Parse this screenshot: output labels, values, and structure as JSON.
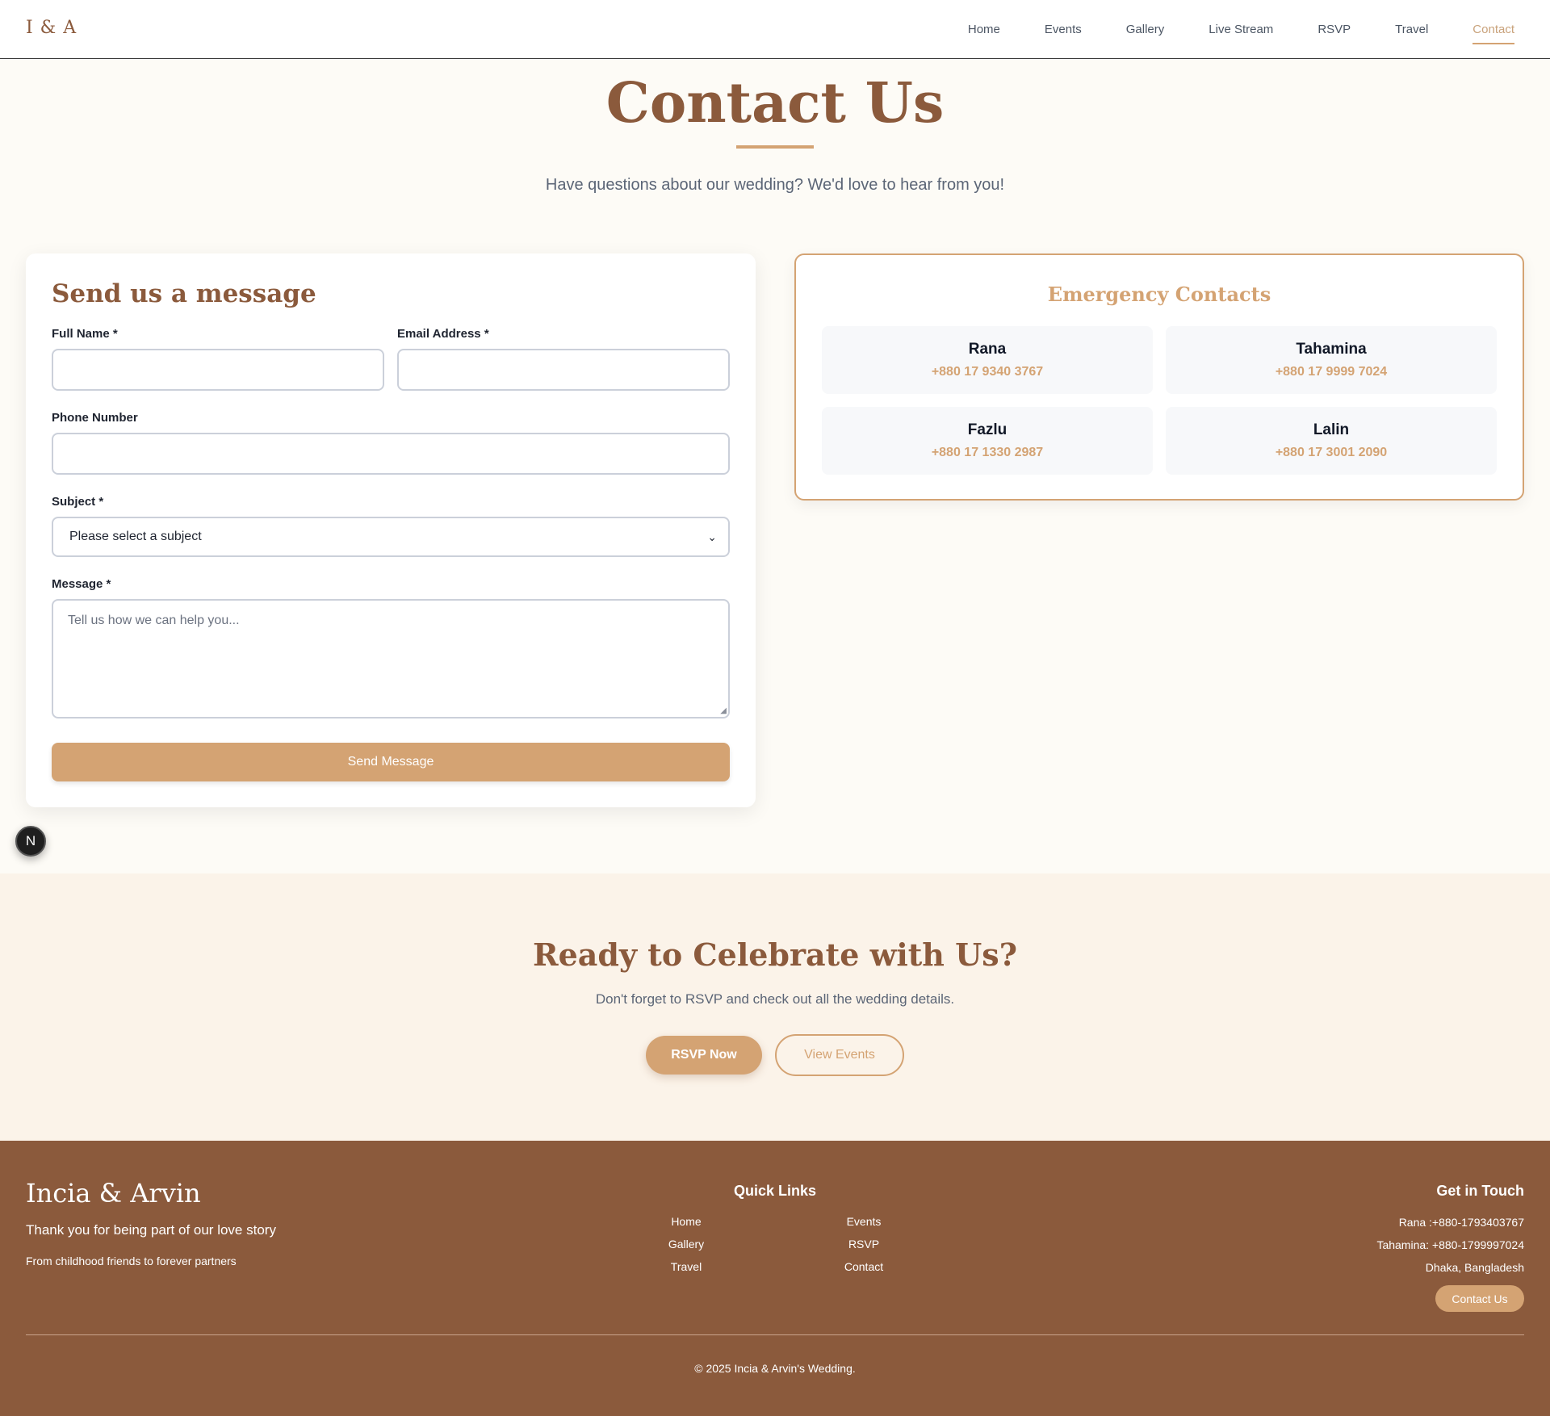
{
  "header": {
    "logo": "I & A",
    "nav": [
      {
        "label": "Home"
      },
      {
        "label": "Events"
      },
      {
        "label": "Gallery"
      },
      {
        "label": "Live Stream"
      },
      {
        "label": "RSVP"
      },
      {
        "label": "Travel"
      },
      {
        "label": "Contact",
        "active": true
      }
    ]
  },
  "hero": {
    "title": "Contact Us",
    "subtitle": "Have questions about our wedding? We'd love to hear from you!"
  },
  "form": {
    "title": "Send us a message",
    "full_name_label": "Full Name *",
    "full_name_value": "",
    "email_label": "Email Address *",
    "email_value": "",
    "phone_label": "Phone Number",
    "phone_value": "",
    "subject_label": "Subject *",
    "subject_selected": "Please select a subject",
    "message_label": "Message *",
    "message_placeholder": "Tell us how we can help you...",
    "submit_label": "Send Message"
  },
  "emergency": {
    "title": "Emergency Contacts",
    "contacts": [
      {
        "name": "Rana",
        "phone": "+880 17 9340 3767"
      },
      {
        "name": "Tahamina",
        "phone": "+880 17 9999 7024"
      },
      {
        "name": "Fazlu",
        "phone": "+880 17 1330 2987"
      },
      {
        "name": "Lalin",
        "phone": "+880 17 3001 2090"
      }
    ]
  },
  "badge": {
    "letter": "N"
  },
  "cta": {
    "title": "Ready to Celebrate with Us?",
    "subtitle": "Don't forget to RSVP and check out all the wedding details.",
    "primary_label": "RSVP Now",
    "secondary_label": "View Events"
  },
  "footer": {
    "brand": "Incia & Arvin",
    "thanks": "Thank you for being part of our love story",
    "tagline": "From childhood friends to forever partners",
    "quick_links_title": "Quick Links",
    "quick_links": [
      "Home",
      "Events",
      "Gallery",
      "RSVP",
      "Travel",
      "Contact"
    ],
    "get_in_touch_title": "Get in Touch",
    "contact_lines": [
      "Rana :+880-1793403767",
      "Tahamina: +880-1799997024",
      "Dhaka, Bangladesh"
    ],
    "contact_button": "Contact Us",
    "copyright": "© 2025 Incia & Arvin's Wedding."
  },
  "colors": {
    "brand_brown": "#8b5a3c",
    "accent_gold": "#d4a373",
    "page_background": "#fdfbf6",
    "cta_background": "#fbf3e9"
  }
}
